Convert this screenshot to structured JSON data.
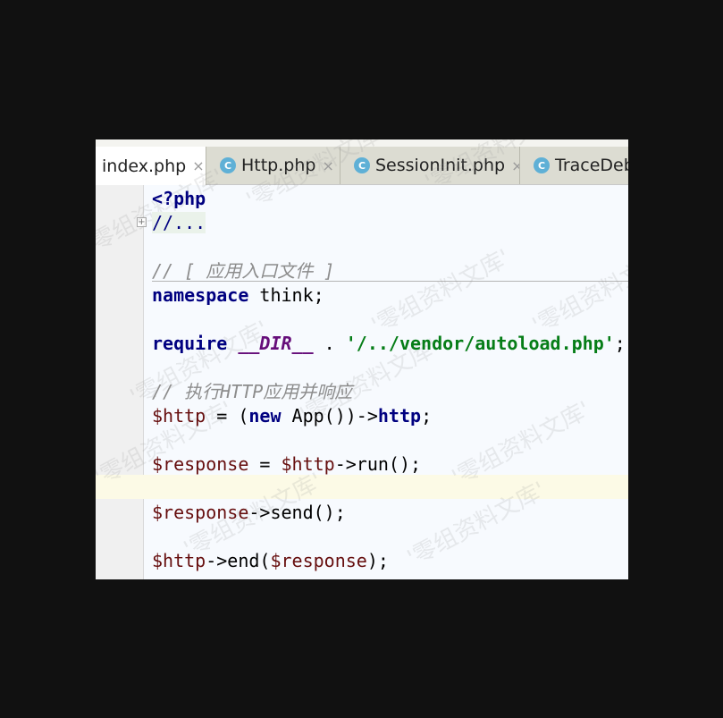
{
  "tabs": [
    {
      "label": "index.php",
      "active": true,
      "icon": "php-file-icon"
    },
    {
      "label": "Http.php",
      "active": false,
      "icon": "class-c-icon"
    },
    {
      "label": "SessionInit.php",
      "active": false,
      "icon": "class-c-icon"
    },
    {
      "label": "TraceDeb",
      "active": false,
      "icon": "class-c-icon"
    }
  ],
  "tab_close_glyph": "×",
  "class_icon_letter": "C",
  "fold_marker": "+",
  "code": {
    "l1": "<?php",
    "l2": "//...",
    "l3": "// [ 应用入口文件 ]",
    "l4_kw": "namespace",
    "l4_rest": " think;",
    "l5_kw": "require",
    "l5_const": "__DIR__",
    "l5_op": " . ",
    "l5_str": "'/../vendor/autoload.php'",
    "l5_end": ";",
    "l6": "// 执行HTTP应用并响应",
    "l7_var": "$http",
    "l7_a": " = (",
    "l7_new": "new",
    "l7_b": " App())->",
    "l7_prop": "http",
    "l7_end": ";",
    "l8_var": "$response",
    "l8_a": " = ",
    "l8_var2": "$http",
    "l8_b": "->run();",
    "l9_var": "$response",
    "l9_b": "->send();",
    "l10_var": "$http",
    "l10_a": "->end(",
    "l10_var2": "$response",
    "l10_b": ");"
  },
  "watermark": "'零组资料文库'",
  "colors": {
    "keyword": "#000080",
    "variable": "#660e0e",
    "string": "#067d17",
    "comment": "#8c8c8c",
    "current_line": "#fcfae6",
    "class_icon": "#5fb0d6"
  }
}
